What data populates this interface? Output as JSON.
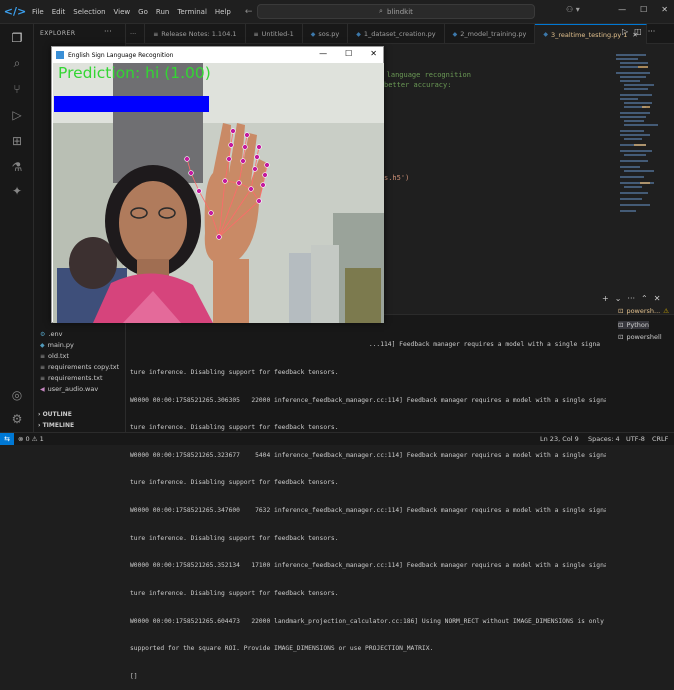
{
  "titlebar": {
    "menus": [
      "File",
      "Edit",
      "Selection",
      "View",
      "Go",
      "Run",
      "Terminal",
      "Help"
    ],
    "search_text": "blindkit"
  },
  "sidebar": {
    "header": "EXPLORER",
    "files": [
      ".env",
      "main.py",
      "old.txt",
      "requirements copy.txt",
      "requirements.txt",
      "user_audio.wav"
    ],
    "outline_label": "OUTLINE",
    "timeline_label": "TIMELINE"
  },
  "tabs": [
    {
      "label": "Release Notes: 1.104.1",
      "icon": "doc-icon",
      "active": false
    },
    {
      "label": "Untitled-1",
      "icon": "doc-icon",
      "active": false
    },
    {
      "label": "sos.py",
      "icon": "python-icon",
      "active": false
    },
    {
      "label": "1_dataset_creation.py",
      "icon": "python-icon",
      "active": false
    },
    {
      "label": "2_model_training.py",
      "icon": "python-icon",
      "active": false
    },
    {
      "label": "3_realtime_testing.py 1",
      "icon": "python-icon",
      "active": true
    }
  ],
  "editor": {
    "line1": "gn language recognition",
    "line2": "better accuracy:",
    "line3": "s.h5')"
  },
  "cv_window": {
    "title": "English Sign Language Recognition",
    "prediction": "Prediction: hi (1.00)",
    "confidence": 1.0,
    "bar_color": "#0000ff",
    "text_color": "#33d633"
  },
  "terminal": {
    "lines": [
      "                                                               ...114] Feedback manager requires a model with a single signa",
      "ture inference. Disabling support for feedback tensors.",
      "W0000 00:00:1758521265.306305   22000 inference_feedback_manager.cc:114] Feedback manager requires a model with a single signa",
      "ture inference. Disabling support for feedback tensors.",
      "W0000 00:00:1758521265.323677    5404 inference_feedback_manager.cc:114] Feedback manager requires a model with a single signa",
      "ture inference. Disabling support for feedback tensors.",
      "W0000 00:00:1758521265.347600    7632 inference_feedback_manager.cc:114] Feedback manager requires a model with a single signa",
      "ture inference. Disabling support for feedback tensors.",
      "W0000 00:00:1758521265.352134   17100 inference_feedback_manager.cc:114] Feedback manager requires a model with a single signa",
      "ture inference. Disabling support for feedback tensors.",
      "W0000 00:00:1758521265.604473   22000 landmark_projection_calculator.cc:186] Using NORM_RECT without IMAGE_DIMENSIONS is only",
      "supported for the square ROI. Provide IMAGE_DIMENSIONS or use PROJECTION_MATRIX.",
      "[]"
    ],
    "sessions": [
      "powersh...",
      "Python",
      "powershell"
    ]
  },
  "statusbar": {
    "problems": "⊗ 0 ⚠ 1",
    "position": "Ln 23, Col 9",
    "spaces": "Spaces: 4",
    "encoding": "UTF-8",
    "eol": "CRLF"
  },
  "colors": {
    "accent": "#0078d4",
    "active_tab_text": "#e2c08d"
  }
}
